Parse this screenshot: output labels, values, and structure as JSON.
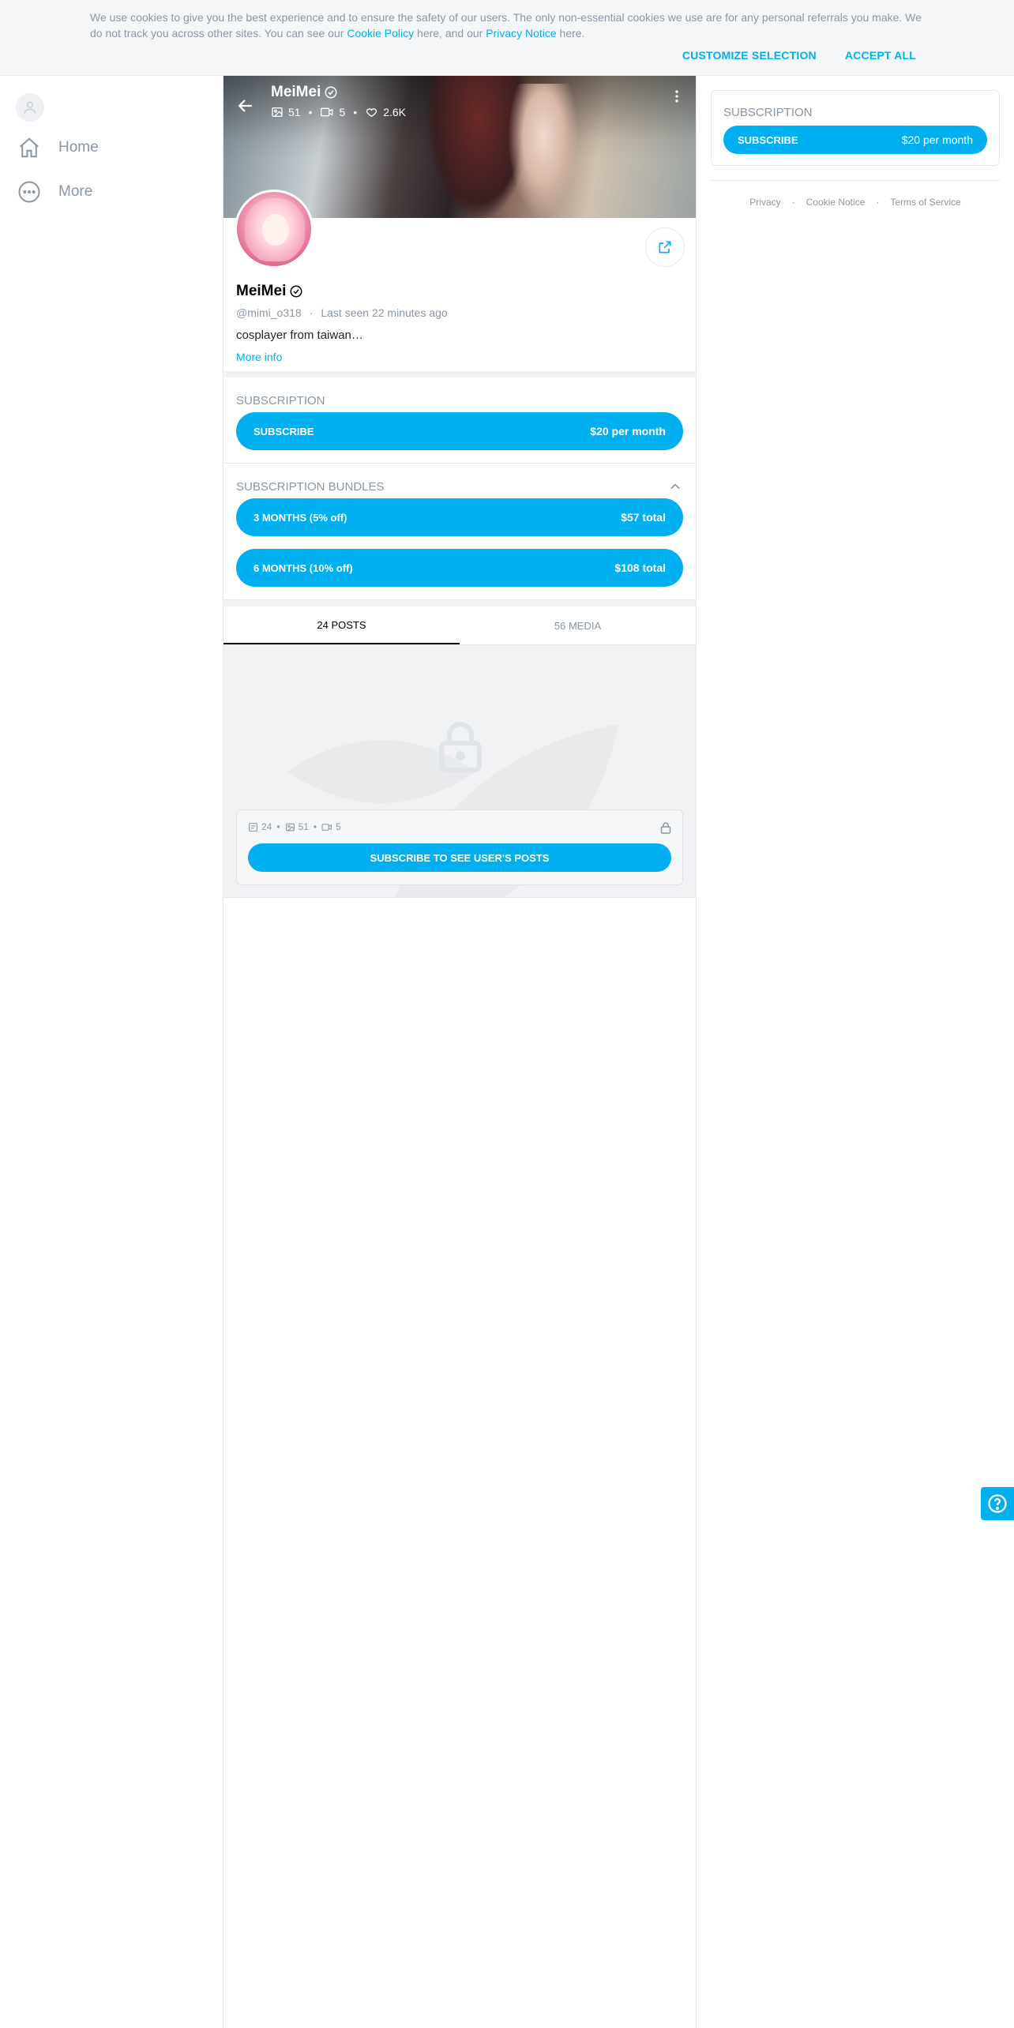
{
  "cookie": {
    "text_before": "We use cookies to give you the best experience and to ensure the safety of our users. The only non-essential cookies we use are for any personal referrals you make. We do not track you across other sites. You can see our ",
    "cookie_policy_link": "Cookie Policy",
    "text_middle": " here, and our ",
    "privacy_notice_link": "Privacy Notice",
    "text_after": " here.",
    "customize_label": "CUSTOMIZE SELECTION",
    "accept_label": "ACCEPT ALL"
  },
  "sidebar": {
    "items": [
      {
        "label": "Home",
        "icon": "home-icon"
      },
      {
        "label": "More",
        "icon": "more-circle-icon"
      }
    ]
  },
  "cover": {
    "name": "MeiMei",
    "photos": "51",
    "videos": "5",
    "likes": "2.6K"
  },
  "profile": {
    "name": "MeiMei",
    "handle": "@mimi_o318",
    "last_seen": "Last seen 22 minutes ago",
    "bio": "cosplayer from taiwan…",
    "more_info": "More info"
  },
  "subscription": {
    "title": "SUBSCRIPTION",
    "button_label": "SUBSCRIBE",
    "price": "$20 per month"
  },
  "bundles": {
    "title": "SUBSCRIPTION BUNDLES",
    "items": [
      {
        "label": "3 MONTHS (5% off)",
        "price": "$57 total"
      },
      {
        "label": "6 MONTHS (10% off)",
        "price": "$108 total"
      }
    ]
  },
  "tabs": [
    {
      "label": "24 POSTS",
      "active": true
    },
    {
      "label": "56 MEDIA",
      "active": false
    }
  ],
  "locked": {
    "posts": "24",
    "photos": "51",
    "videos": "5",
    "button_label": "SUBSCRIBE TO SEE USER'S POSTS"
  },
  "right": {
    "subscription_title": "SUBSCRIPTION",
    "button_label": "SUBSCRIBE",
    "price": "$20 per month",
    "footer": [
      "Privacy",
      "Cookie Notice",
      "Terms of Service"
    ]
  },
  "colors": {
    "accent": "#00aff0",
    "muted": "#8a96a3"
  }
}
